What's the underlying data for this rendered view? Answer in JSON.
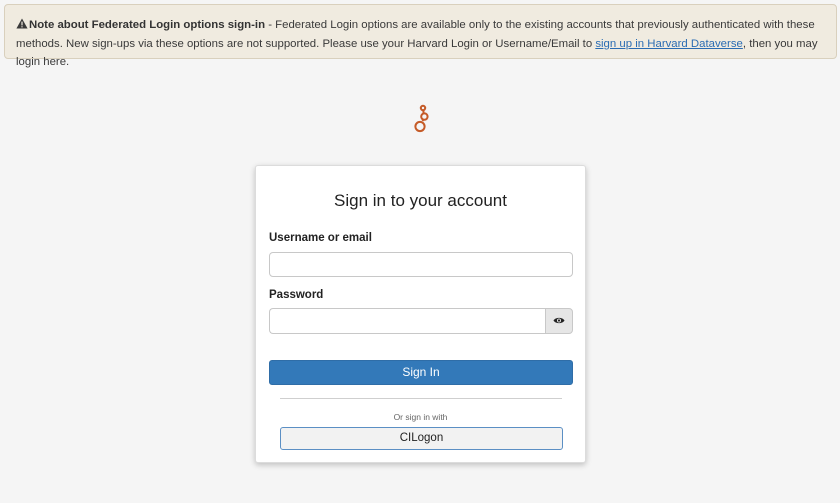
{
  "alert": {
    "title": "Note about Federated Login options sign-in",
    "text_before_link": " - Federated Login options are available only to the existing accounts that previously authenticated with these methods. New sign-ups via these options are not supported. Please use your Harvard Login or Username/Email to ",
    "link_text": "sign up in Harvard Dataverse",
    "text_after_link": ", then you may login here.",
    "icon": "warning-icon"
  },
  "logo": {
    "icon": "dataverse-logo",
    "color": "#c55b28"
  },
  "login": {
    "title": "Sign in to your account",
    "username_label": "Username or email",
    "username_value": "",
    "password_label": "Password",
    "password_value": "",
    "show_password_icon": "eye-icon",
    "signin_label": "Sign In",
    "or_text": "Or sign in with",
    "provider_label": "CILogon"
  },
  "colors": {
    "accent": "#3379b9",
    "alert_bg": "#f0ebe0",
    "link": "#2a6cb3"
  }
}
